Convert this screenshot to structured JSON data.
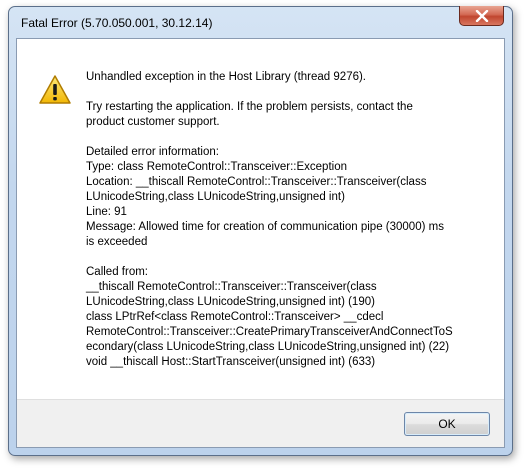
{
  "window": {
    "title": "Fatal Error (5.70.050.001, 30.12.14)",
    "close_icon": "close-icon",
    "close_color": "#c74a33"
  },
  "icon": {
    "name": "warning-icon",
    "color": "#f5c518"
  },
  "message": {
    "headline": "Unhandled exception in the Host Library (thread 9276).",
    "advice": [
      "Try restarting the application. If the problem persists, contact the",
      "product customer support."
    ],
    "details": [
      "Detailed error information:",
      "Type: class RemoteControl::Transceiver::Exception",
      "Location: __thiscall RemoteControl::Transceiver::Transceiver(class",
      "LUnicodeString,class LUnicodeString,unsigned int)",
      "Line: 91",
      "Message: Allowed time for creation of communication pipe (30000) ms",
      "is exceeded"
    ],
    "called_from": [
      "Called from:",
      "__thiscall RemoteControl::Transceiver::Transceiver(class",
      "LUnicodeString,class LUnicodeString,unsigned int) (190)",
      "class LPtrRef<class RemoteControl::Transceiver> __cdecl",
      "RemoteControl::Transceiver::CreatePrimaryTransceiverAndConnectToS",
      "econdary(class LUnicodeString,class LUnicodeString,unsigned int) (22)",
      "void __thiscall Host::StartTransceiver(unsigned int) (633)"
    ]
  },
  "buttons": {
    "ok_label": "OK"
  }
}
